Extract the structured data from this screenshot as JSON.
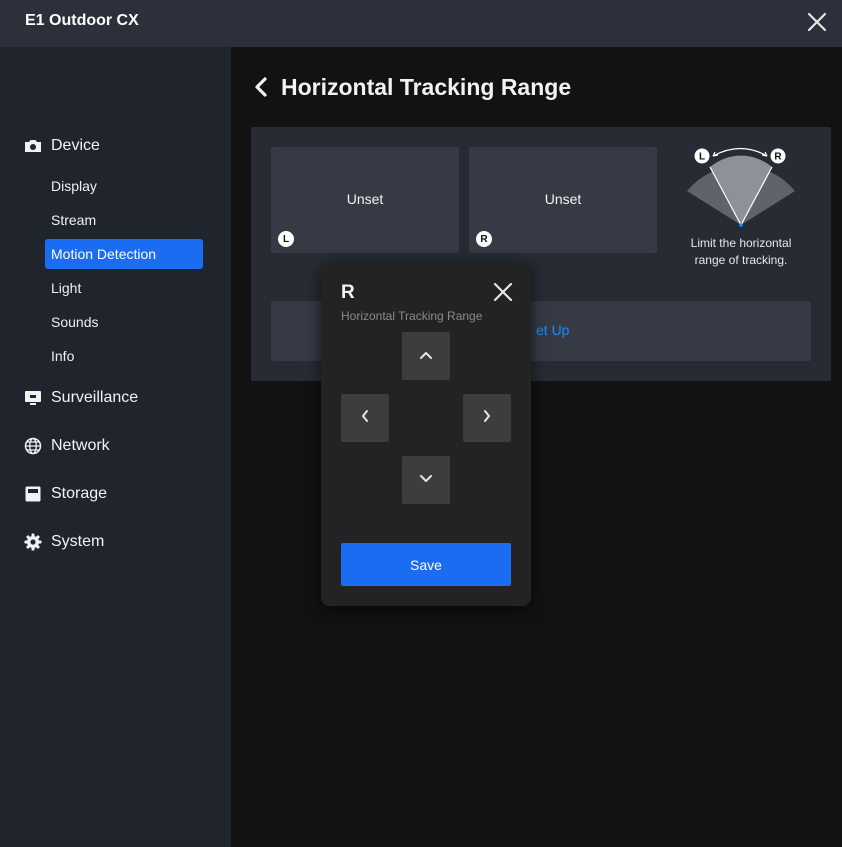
{
  "window": {
    "title": "E1 Outdoor CX",
    "close_icon": "close-icon"
  },
  "sidebar": {
    "device": {
      "label": "Device",
      "icon": "camera-icon"
    },
    "device_items": [
      {
        "label": "Display"
      },
      {
        "label": "Stream"
      },
      {
        "label": "Motion Detection",
        "active": true
      },
      {
        "label": "Light"
      },
      {
        "label": "Sounds"
      },
      {
        "label": "Info"
      }
    ],
    "surveillance": {
      "label": "Surveillance",
      "icon": "monitor-icon"
    },
    "network": {
      "label": "Network",
      "icon": "globe-icon"
    },
    "storage": {
      "label": "Storage",
      "icon": "storage-icon"
    },
    "system": {
      "label": "System",
      "icon": "gear-icon"
    }
  },
  "page": {
    "title": "Horizontal Tracking Range",
    "left_position": {
      "value": "Unset",
      "badge": "L"
    },
    "right_position": {
      "value": "Unset",
      "badge": "R"
    },
    "illustration": {
      "left_marker": "L",
      "right_marker": "R"
    },
    "description": "Limit the horizontal range of tracking.",
    "setup_button_visible": "et Up"
  },
  "popup": {
    "title": "R",
    "subtitle": "Horizontal Tracking Range",
    "save_label": "Save"
  },
  "colors": {
    "accent": "#1a6cf2",
    "link": "#1a8cff",
    "titlebar": "#2b303b",
    "sidebar": "#20242d",
    "panel": "#272b34"
  }
}
